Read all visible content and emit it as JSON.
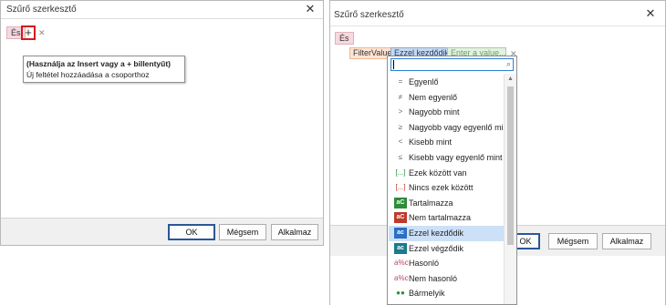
{
  "dialog1": {
    "title": "Szűrő szerkesztő",
    "close": "✕",
    "and_label": "És",
    "add_symbol": "+",
    "remove_symbol": "✕",
    "tooltip": {
      "title": "(Használja az Insert vagy a + billentyűt)",
      "description": "Új feltétel hozzáadása a csoporthoz"
    },
    "buttons": {
      "ok": "OK",
      "cancel": "Mégsem",
      "apply": "Alkalmaz"
    }
  },
  "dialog2": {
    "title": "Szűrő szerkesztő",
    "close": "✕",
    "and_label": "És",
    "condition": {
      "field": "FilterValue",
      "operator": "Ezzel kezdődik",
      "value_placeholder": "Enter a value...",
      "remove": "✕"
    },
    "buttons": {
      "ok": "OK",
      "cancel": "Mégsem",
      "apply": "Alkalmaz"
    },
    "dropdown": {
      "search_icon": "⌕",
      "scroll_up": "▲",
      "selected_index": 10,
      "options": [
        {
          "label": "Egyenlő",
          "icon": "="
        },
        {
          "label": "Nem egyenlő",
          "icon": "≠"
        },
        {
          "label": "Nagyobb mint",
          "icon": ">"
        },
        {
          "label": "Nagyobb vagy egyenlő mint",
          "icon": "≥"
        },
        {
          "label": "Kisebb mint",
          "icon": "<"
        },
        {
          "label": "Kisebb vagy egyenlő mint",
          "icon": "≤"
        },
        {
          "label": "Ezek között van",
          "icon": "[...]"
        },
        {
          "label": "Nincs ezek között",
          "icon": "[...]"
        },
        {
          "label": "Tartalmazza",
          "icon": "aC"
        },
        {
          "label": "Nem tartalmazza",
          "icon": "aC"
        },
        {
          "label": "Ezzel kezdődik",
          "icon": "ac"
        },
        {
          "label": "Ezzel végződik",
          "icon": "ac"
        },
        {
          "label": "Hasonló",
          "icon": "a%c"
        },
        {
          "label": "Nem hasonló",
          "icon": "a%c"
        },
        {
          "label": "Bármelyik",
          "icon": "●●"
        }
      ]
    }
  }
}
